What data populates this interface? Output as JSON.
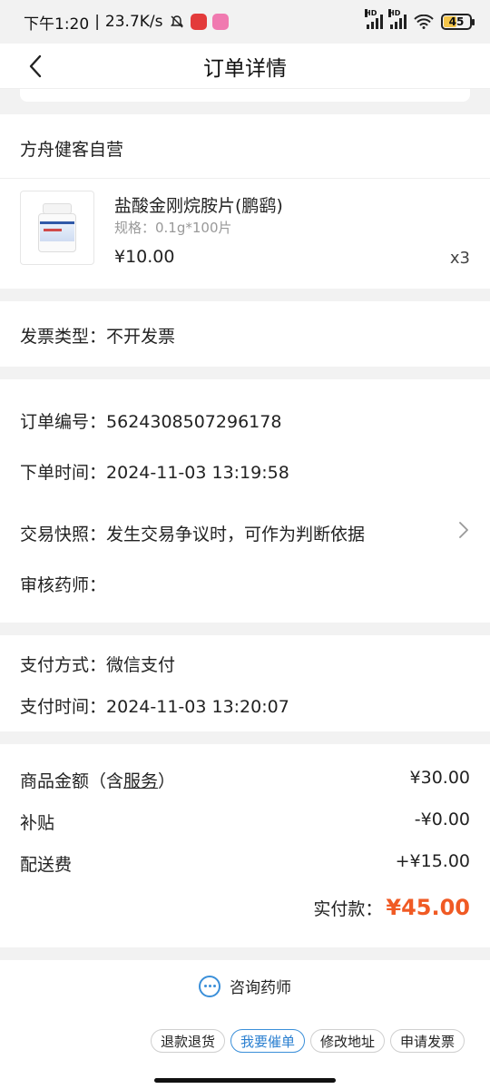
{
  "status_bar": {
    "time": "下午1:20",
    "speed": "23.7K/s",
    "battery": "45",
    "battery_level": 0.45
  },
  "header": {
    "title": "订单详情"
  },
  "shop": {
    "name": "方舟健客自营"
  },
  "product": {
    "name": "盐酸金刚烷胺片(鹏鹞)",
    "spec": "规格：0.1g*100片",
    "price": "¥10.00",
    "qty": "x3"
  },
  "invoice": {
    "label": "发票类型：",
    "value": "不开发票"
  },
  "order": {
    "number_label": "订单编号：",
    "number": "5624308507296178",
    "time_label": "下单时间：",
    "time": "2024-11-03 13:19:58",
    "snapshot_label": "交易快照：",
    "snapshot": "发生交易争议时，可作为判断依据",
    "pharmacist_label": "审核药师："
  },
  "payment": {
    "method_label": "支付方式：",
    "method": "微信支付",
    "time_label": "支付时间：",
    "time": "2024-11-03 13:20:07"
  },
  "amounts": {
    "goods_label_prefix": "商品金额（含",
    "goods_label_link": "服务",
    "goods_label_suffix": "）",
    "goods_value": "¥30.00",
    "subsidy_label": "补贴",
    "subsidy_value": "-¥0.00",
    "shipping_label": "配送费",
    "shipping_value": "+¥15.00",
    "total_label": "实付款：",
    "total_value": "¥45.00"
  },
  "footer": {
    "consult": "咨询药师",
    "buttons": [
      "退款退货",
      "我要催单",
      "修改地址",
      "申请发票"
    ]
  },
  "colors": {
    "accent": "#3a8fd9",
    "price_red": "#f05a24"
  }
}
